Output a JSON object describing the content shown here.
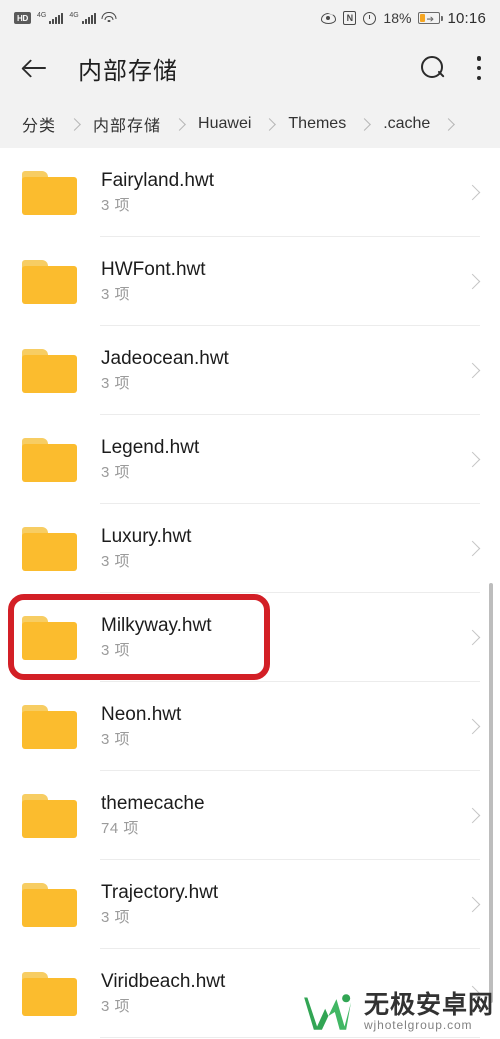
{
  "status_bar": {
    "hd_label": "HD",
    "network_label": "4G",
    "network_label_2": "4G",
    "wifi_icon": "wifi-icon",
    "eye_comfort_icon": "eye-comfort-icon",
    "nfc_label": "N",
    "alarm_icon": "alarm-clock-icon",
    "battery_percent": "18%",
    "battery_charging": true,
    "time": "10:16"
  },
  "app_bar": {
    "back_icon": "back-arrow-icon",
    "title": "内部存储",
    "search_icon": "search-icon",
    "overflow_icon": "overflow-menu-icon"
  },
  "breadcrumb": {
    "items": [
      {
        "label": "分类",
        "cn": true
      },
      {
        "label": "内部存储",
        "cn": true
      },
      {
        "label": "Huawei",
        "cn": false
      },
      {
        "label": "Themes",
        "cn": false
      },
      {
        "label": ".cache",
        "cn": false
      }
    ]
  },
  "file_list": {
    "items": [
      {
        "name": "Fairyland.hwt",
        "count": "3 项",
        "icon": "folder-icon",
        "highlighted": false
      },
      {
        "name": "HWFont.hwt",
        "count": "3 项",
        "icon": "folder-icon",
        "highlighted": false
      },
      {
        "name": "Jadeocean.hwt",
        "count": "3 项",
        "icon": "folder-icon",
        "highlighted": false
      },
      {
        "name": "Legend.hwt",
        "count": "3 项",
        "icon": "folder-icon",
        "highlighted": false
      },
      {
        "name": "Luxury.hwt",
        "count": "3 项",
        "icon": "folder-icon",
        "highlighted": false
      },
      {
        "name": "Milkyway.hwt",
        "count": "3 项",
        "icon": "folder-icon",
        "highlighted": true
      },
      {
        "name": "Neon.hwt",
        "count": "3 项",
        "icon": "folder-icon",
        "highlighted": false
      },
      {
        "name": "themecache",
        "count": "74 项",
        "icon": "folder-icon",
        "highlighted": false
      },
      {
        "name": "Trajectory.hwt",
        "count": "3 项",
        "icon": "folder-icon",
        "highlighted": false
      },
      {
        "name": "Viridbeach.hwt",
        "count": "3 项",
        "icon": "folder-icon",
        "highlighted": false
      }
    ]
  },
  "watermark": {
    "site_name": "无极安卓网",
    "url": "wjhotelgroup.com",
    "logo_color": "#2ca34f"
  },
  "colors": {
    "folder": "#fbbc2e",
    "folder_tab": "#f7cd63",
    "highlight": "#d31f26",
    "bar_background": "#f2f2f2",
    "list_background": "#ffffff",
    "divider": "#ececec",
    "scrollbar": "#bdbdbd"
  }
}
